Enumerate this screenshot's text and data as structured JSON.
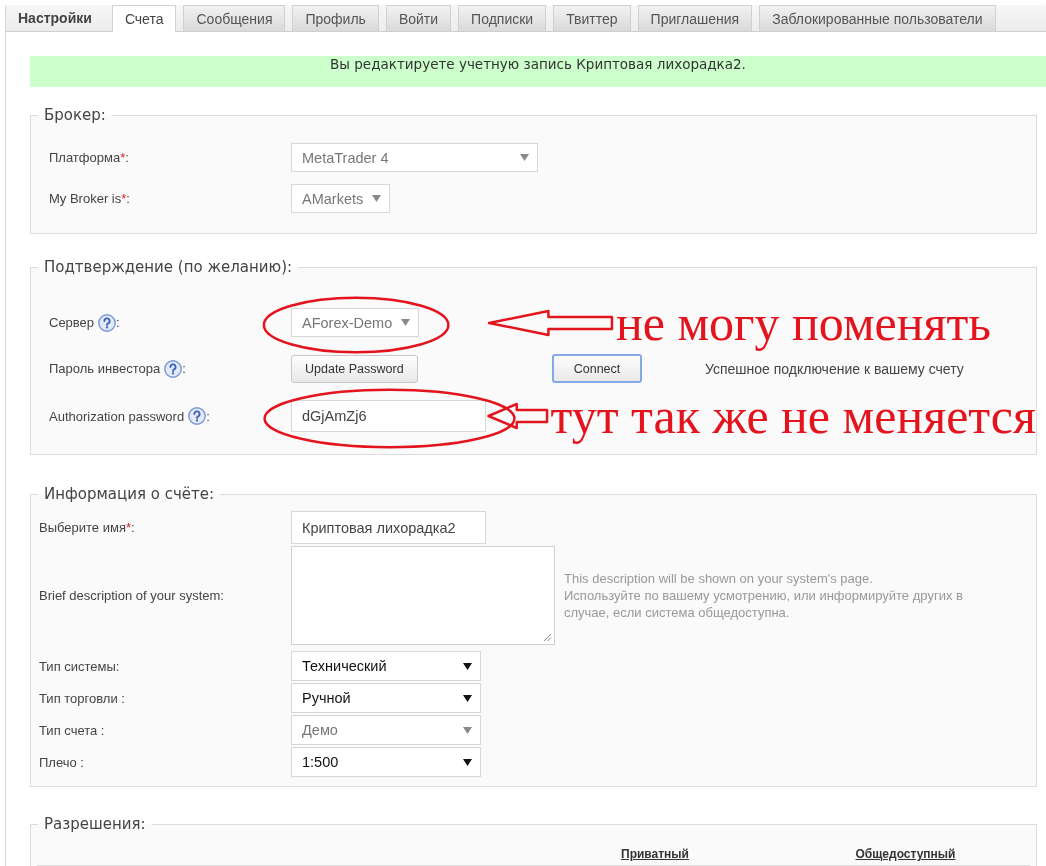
{
  "settings_nav": {
    "title": "Настройки",
    "tabs": [
      {
        "label": "Счета",
        "selected": true
      },
      {
        "label": "Сообщения",
        "selected": false
      },
      {
        "label": "Профиль",
        "selected": false
      },
      {
        "label": "Войти",
        "selected": false
      },
      {
        "label": "Подписки",
        "selected": false
      },
      {
        "label": "Твиттер",
        "selected": false
      },
      {
        "label": "Приглашения",
        "selected": false
      },
      {
        "label": "Заблокированные пользователи",
        "selected": false
      }
    ]
  },
  "notice": "Вы редактируете учетную запись Криптовая лихорадка2.",
  "sections": [
    {
      "kind": "form",
      "legend": "Брокер:",
      "rows": [
        {
          "label": "Платформа",
          "required_mark": "*",
          "colon": ":",
          "help": false,
          "controls": [
            {
              "kind": "select",
              "value": "MetaTrader 4",
              "disabled": true
            }
          ]
        },
        {
          "label": "My Broker is",
          "required_mark": "*",
          "colon": ":",
          "help": false,
          "controls": [
            {
              "kind": "select",
              "value": "AMarkets",
              "disabled": true
            }
          ]
        }
      ]
    },
    {
      "kind": "form",
      "legend": "Подтверждение (по желанию):",
      "rows": [
        {
          "label": "Сервер",
          "help": true,
          "colon": ":",
          "controls": [
            {
              "kind": "select",
              "value": "AForex-Demo",
              "disabled": true
            }
          ],
          "annotation": "не могу поменять"
        },
        {
          "label": "Пароль инвестора",
          "help": true,
          "colon": ":",
          "controls": [
            {
              "kind": "button",
              "label": "Update Password",
              "focused": false
            },
            {
              "kind": "button",
              "label": "Connect",
              "focused": true
            },
            {
              "kind": "status",
              "text": "Успешное подключение к вашему счету"
            }
          ]
        },
        {
          "label": "Authorization password",
          "help": true,
          "colon": ":",
          "controls": [
            {
              "kind": "input",
              "value": "dGjAmZj6"
            }
          ],
          "annotation": "тут так же не меняется"
        }
      ]
    },
    {
      "kind": "table",
      "legend": "Информация о счёте:",
      "rows": [
        {
          "label": "Выберите имя",
          "required_mark": "*",
          "colon": ":",
          "help": false,
          "controls": [
            {
              "kind": "input",
              "value": "Криптовая лихорадка2"
            }
          ]
        },
        {
          "label": "Brief description of your system:",
          "help": false,
          "controls": [
            {
              "kind": "textarea"
            },
            {
              "kind": "hint",
              "lines": [
                "This description will be shown on your system's page.",
                "Используйте по вашему усмотрению, или информируйте других в случае, если система общедоступна."
              ]
            }
          ]
        },
        {
          "label": "Тип системы:",
          "help": false,
          "controls": [
            {
              "kind": "select",
              "value": "Технический",
              "disabled": false
            }
          ]
        },
        {
          "label": "Тип торговли :",
          "help": false,
          "controls": [
            {
              "kind": "select",
              "value": "Ручной",
              "disabled": false
            }
          ]
        },
        {
          "label": "Тип счета :",
          "help": false,
          "controls": [
            {
              "kind": "select",
              "value": "Демо",
              "disabled": true
            }
          ]
        },
        {
          "label": "Плечо :",
          "help": false,
          "controls": [
            {
              "kind": "select",
              "value": "1:500",
              "disabled": false
            }
          ]
        }
      ]
    },
    {
      "kind": "permissions",
      "legend": "Разрешения:",
      "columns": [
        "Приватный",
        "Общедоступный"
      ]
    }
  ]
}
